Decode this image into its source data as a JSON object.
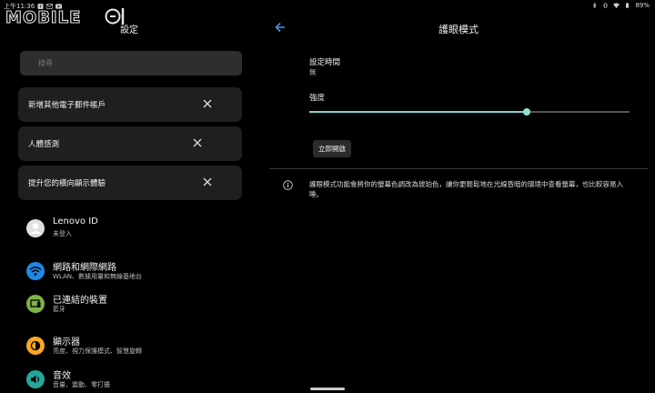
{
  "status_bar": {
    "time": "上午11:36",
    "battery": "89%",
    "icons": [
      "facebook-icon",
      "mail-icon",
      "youtube-icon",
      "bluetooth-icon",
      "vibrate-icon",
      "wifi-icon",
      "battery-icon"
    ]
  },
  "watermark": {
    "brand": "MOBILE01"
  },
  "left_panel": {
    "title": "設定",
    "search": {
      "placeholder": "搜尋"
    },
    "suggestions": [
      {
        "label": "新增其他電子郵件帳戶"
      },
      {
        "label": "人體感測"
      },
      {
        "label": "提升您的橫向顯示體驗"
      }
    ],
    "items": [
      {
        "title": "Lenovo ID",
        "subtitle": "未登入",
        "icon": "account-icon",
        "color": "#e0e0e0"
      },
      {
        "title": "網路和網際網路",
        "subtitle": "WLAN、數據用量和無線基地台",
        "icon": "wifi-icon",
        "color": "#1e88e5"
      },
      {
        "title": "已連結的裝置",
        "subtitle": "藍牙",
        "icon": "devices-icon",
        "color": "#7cb342"
      },
      {
        "title": "顯示器",
        "subtitle": "亮度、視力保護模式、智慧旋轉",
        "icon": "brightness-icon",
        "color": "#f9a825"
      },
      {
        "title": "音效",
        "subtitle": "音量、震動、零打擾",
        "icon": "volume-icon",
        "color": "#26a69a"
      }
    ]
  },
  "right_panel": {
    "title": "護眼模式",
    "schedule": {
      "label": "設定時間",
      "value": "無"
    },
    "intensity": {
      "label": "強度",
      "level_percent": 68,
      "accent": "#7fd3cf"
    },
    "turn_on_button": "立即開啟",
    "info": "護眼模式功能會將你的螢幕色調改為琥珀色，讓你更輕鬆地在光線昏暗的環境中查看螢幕，也比較容易入睡。"
  }
}
